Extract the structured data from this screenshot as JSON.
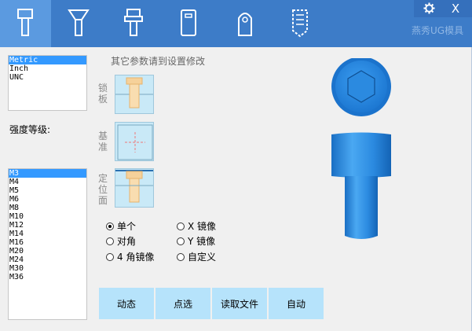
{
  "window": {
    "settings_icon": "gear-icon",
    "close_label": "X",
    "brand": "燕秀UG模具"
  },
  "tabs": [
    {
      "name": "socket-head-screw",
      "icon": "socket-screw-icon",
      "selected": true
    },
    {
      "name": "countersunk-screw",
      "icon": "countersunk-screw-icon",
      "selected": false
    },
    {
      "name": "hex-bolt",
      "icon": "hex-bolt-icon",
      "selected": false
    },
    {
      "name": "plate-part",
      "icon": "plate-icon",
      "selected": false
    },
    {
      "name": "pin-part",
      "icon": "pin-icon",
      "selected": false
    },
    {
      "name": "threaded-hole",
      "icon": "threaded-hole-icon",
      "selected": false
    }
  ],
  "units": {
    "items": [
      "Metric",
      "Inch",
      "UNC"
    ],
    "selected": "Metric"
  },
  "strength_label": "强度等级:",
  "sizes": {
    "items": [
      "M3",
      "M4",
      "M5",
      "M6",
      "M8",
      "M10",
      "M12",
      "M14",
      "M16",
      "M20",
      "M24",
      "M30",
      "M36"
    ],
    "selected": "M3"
  },
  "hint": "其它参数请到设置修改",
  "modes": [
    {
      "label": "锁板",
      "icon": "lock-plate-icon"
    },
    {
      "label": "基准",
      "icon": "datum-icon"
    },
    {
      "label": "定位面",
      "icon": "locating-face-icon"
    }
  ],
  "layout_options": {
    "left": [
      "单个",
      "对角",
      "4 角镜像"
    ],
    "right": [
      "X 镜像",
      "Y 镜像",
      "自定义"
    ],
    "selected": "单个"
  },
  "buttons": [
    "动态",
    "点选",
    "读取文件",
    "自动"
  ],
  "colors": {
    "header": "#3d7cc8",
    "selected_tab": "#5b9ae0",
    "list_selection": "#3399ff",
    "button": "#b6e3fb",
    "model": "#2f8fe0"
  }
}
